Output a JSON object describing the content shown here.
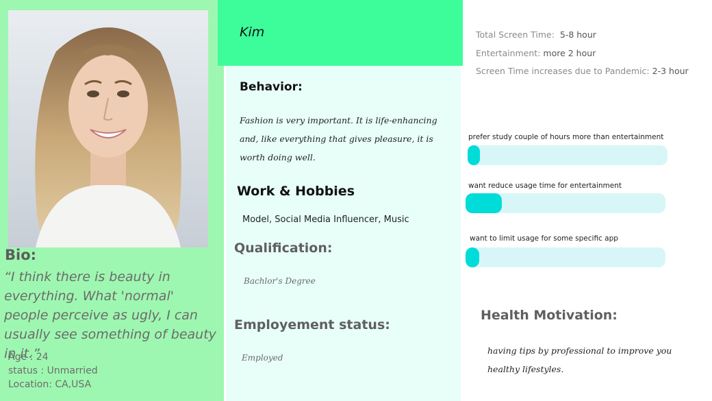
{
  "persona": {
    "name": "Kim",
    "bio_title": "Bio:",
    "bio_quote": "“I think there is beauty in everything. What 'normal' people perceive as ugly, I can usually see something of beauty in it.”",
    "age": "Age : 24",
    "status": "status : Unmarried",
    "location": "Location: CA,USA"
  },
  "behavior": {
    "title": "Behavior:",
    "text": "Fashion is very important. It is life-enhancing and, like everything that gives pleasure, it is worth doing well."
  },
  "work": {
    "title": "Work & Hobbies",
    "text": "Model, Social Media Influencer, Music"
  },
  "qualification": {
    "title": "Qualification:",
    "text": "Bachlor's Degree"
  },
  "employment": {
    "title": "Employement status:",
    "text": "Employed"
  },
  "screen_time": [
    {
      "label": "Total Screen Time:",
      "value": "5-8 hour"
    },
    {
      "label": "Entertainment:",
      "value": "more 2 hour"
    },
    {
      "label": "Screen Time increases due to Pandemic:",
      "value": "2-3 hour"
    }
  ],
  "bars": [
    {
      "label": "prefer study couple of hours more than entertainment",
      "fill": 0.06
    },
    {
      "label": "want reduce usage time for entertainment",
      "fill": 0.18
    },
    {
      "label": "want to limit usage for some specific app",
      "fill": 0.07
    }
  ],
  "health": {
    "title": "Health Motivation:",
    "text": "having tips by professional to improve you healthy lifestyles."
  },
  "colors": {
    "left_panel": "#9ef7b0",
    "name_banner": "#3dfd9b",
    "middle_panel": "#e8fff9",
    "bar_track": "#d8f6f7",
    "bar_fill": "#00dcd8"
  }
}
